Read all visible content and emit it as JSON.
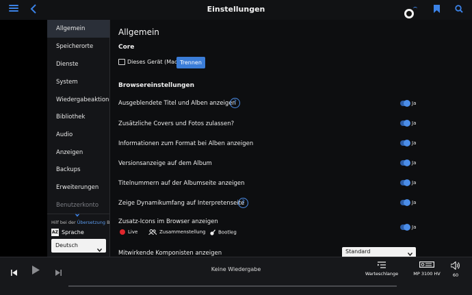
{
  "header": {
    "title": "Einstellungen",
    "accent": "#3b82e6"
  },
  "sidebar": {
    "items": [
      {
        "label": "Allgemein"
      },
      {
        "label": "Speicherorte"
      },
      {
        "label": "Dienste"
      },
      {
        "label": "System"
      },
      {
        "label": "Wiedergabeaktionen"
      },
      {
        "label": "Bibliothek"
      },
      {
        "label": "Audio"
      },
      {
        "label": "Anzeigen"
      },
      {
        "label": "Backups"
      },
      {
        "label": "Erweiterungen"
      },
      {
        "label": "Benutzerkonto"
      }
    ],
    "help_prefix": "Hilf bei der",
    "help_link": "Übersetzung",
    "help_suffix": "B",
    "language_icon": "AZ",
    "language_label": "Sprache",
    "language_value": "Deutsch"
  },
  "main": {
    "title": "Allgemein",
    "core_heading": "Core",
    "device_label": "Dieses Gerät (Mac)",
    "disconnect_label": "Trennen",
    "browser_heading": "Browsereinstellungen",
    "options": [
      {
        "label": "Ausgeblendete Titel und Alben anzeigen",
        "value": "Ja"
      },
      {
        "label": "Zusätzliche Covers und Fotos zulassen?",
        "value": "Ja"
      },
      {
        "label": "Informationen zum Format bei Alben anzeigen",
        "value": "Ja"
      },
      {
        "label": "Versionsanzeige auf dem Album",
        "value": "Ja"
      },
      {
        "label": "Titelnummern auf der Albumseite anzeigen",
        "value": "Ja"
      },
      {
        "label": "Zeige Dynamikumfang auf Interpretenseite",
        "value": "Ja"
      },
      {
        "label": "Zusatz-Icons im Browser anzeigen",
        "value": "Ja"
      }
    ],
    "help_glyph": "?",
    "badges": {
      "live": "Live",
      "compilation": "Zusammenstellung",
      "bootleg": "Bootleg"
    },
    "composers_label": "Mitwirkende Komponisten anzeigen",
    "composers_value": "Standard"
  },
  "player": {
    "status": "Keine Wiedergabe",
    "queue_label": "Warteschlange",
    "zone_label": "MP 3100 HV",
    "volume_value": "60"
  }
}
